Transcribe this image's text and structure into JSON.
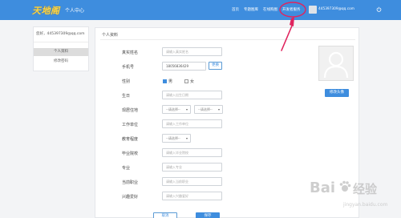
{
  "header": {
    "logo_text": "天地阁",
    "site_title": "个人中心",
    "nav": [
      "首页",
      "专题图库",
      "在线购图",
      "开发者服务"
    ],
    "user_email": "445397309@qq.com"
  },
  "sidebar": {
    "greeting": "您好，445397309@qq.com",
    "items": [
      {
        "label": "个人资料",
        "active": true
      },
      {
        "label": "修改密码",
        "active": false
      }
    ]
  },
  "form": {
    "section_title": "个人资料",
    "fields": {
      "real_name": {
        "label": "真实姓名",
        "placeholder": "请输入真实姓名"
      },
      "phone": {
        "label": "手机号",
        "value": "18056836429"
      },
      "send_button": "更换",
      "gender": {
        "label": "性别",
        "options": [
          "男",
          "女"
        ],
        "selected": "男"
      },
      "birthday": {
        "label": "生日",
        "placeholder": "请输入出生日期"
      },
      "residence": {
        "label": "现居住地",
        "province": "--请选择--",
        "city": "--请选择--"
      },
      "company": {
        "label": "工作单位",
        "placeholder": "请输入工作单位"
      },
      "education": {
        "label": "教育程度",
        "selected": "--请选择--"
      },
      "school": {
        "label": "毕业院校",
        "placeholder": "请输入毕业院校"
      },
      "major": {
        "label": "专业",
        "placeholder": "请输入专业"
      },
      "occupation": {
        "label": "当前职业",
        "placeholder": "请输入当前职业"
      },
      "hobby": {
        "label": "兴趣爱好",
        "placeholder": "请输入兴趣爱好"
      }
    },
    "avatar_button": "修改头像",
    "cancel_button": "取消",
    "save_button": "保存"
  },
  "watermark": {
    "brand": "Bai",
    "brand2": "经验",
    "url": "jingyan.baidu.com"
  },
  "colors": {
    "header_bg": "#3e8dde",
    "accent": "#3e8dde",
    "annotation": "#e0245e"
  }
}
